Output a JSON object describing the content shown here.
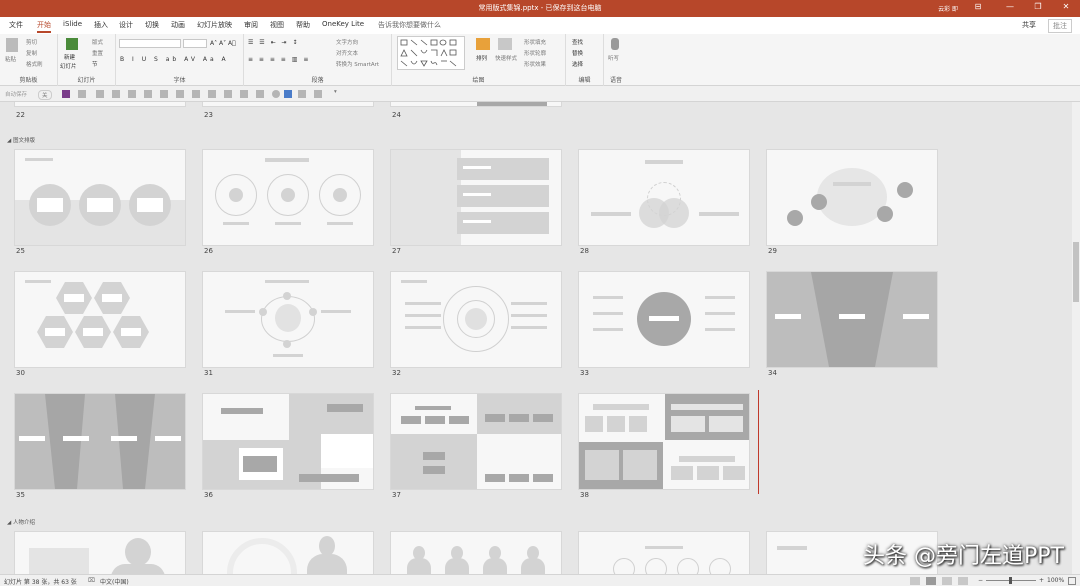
{
  "window": {
    "title": "常用版式集锦.pptx - 已保存到这台电脑",
    "user": "云彩 即",
    "controls": [
      "—",
      "❐",
      "✕",
      "⊟"
    ]
  },
  "tabs": [
    "文件",
    "开始",
    "iSlide",
    "插入",
    "设计",
    "切换",
    "动画",
    "幻灯片放映",
    "审阅",
    "视图",
    "帮助",
    "OneKey Lite",
    "告诉我你想要做什么"
  ],
  "active_tab": "开始",
  "share_label": "共享",
  "comment_label": "批注",
  "ribbon": {
    "groups": [
      "剪贴板",
      "幻灯片",
      "字体",
      "段落",
      "绘图",
      "编辑",
      "语音"
    ],
    "clipboard": {
      "paste": "粘贴",
      "cut": "剪切",
      "copy": "复制",
      "format_painter": "格式刷"
    },
    "slides": {
      "new_slide": "新建",
      "new_slide_sub": "幻灯片",
      "layout": "版式",
      "reset": "重置",
      "section": "节"
    },
    "paragraph": {
      "text_direction": "文字方向",
      "align_text": "对齐文本",
      "smartart": "转换为 SmartArt"
    },
    "drawing": {
      "arrange": "排列",
      "quick_styles": "快速样式",
      "fill": "形状填充",
      "outline": "形状轮廓",
      "effects": "形状效果"
    },
    "editing": {
      "find": "查找",
      "replace": "替换",
      "select": "选择"
    },
    "voice": {
      "dictate": "听写"
    }
  },
  "qat": {
    "autosave": "自动保存",
    "autosave_state": "关"
  },
  "sections": [
    {
      "name": "图文排版"
    },
    {
      "name": "人物介绍"
    }
  ],
  "slide_numbers": [
    "22",
    "23",
    "24",
    "25",
    "26",
    "27",
    "28",
    "29",
    "30",
    "31",
    "32",
    "33",
    "34",
    "35",
    "36",
    "37",
    "38"
  ],
  "statusbar": {
    "slide_info": "幻灯片 第 38 张，共 63 张",
    "language": "中文(中国)",
    "zoom": "100%"
  },
  "watermark": "头条 @旁门左道PPT"
}
